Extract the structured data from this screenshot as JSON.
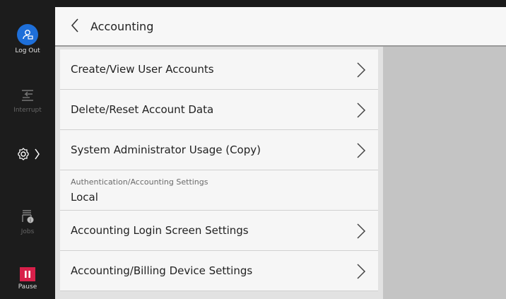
{
  "rail": {
    "logout_label": "Log Out",
    "interrupt_label": "Interrupt",
    "jobs_label": "Jobs",
    "pause_label": "Pause"
  },
  "header": {
    "title": "Accounting"
  },
  "menu": {
    "create_view": "Create/View User Accounts",
    "delete_reset": "Delete/Reset Account Data",
    "sysadmin_usage": "System Administrator Usage (Copy)",
    "auth_settings_label": "Authentication/Accounting Settings",
    "auth_settings_value": "Local",
    "login_screen": "Accounting Login Screen Settings",
    "billing_device": "Accounting/Billing Device Settings"
  },
  "colors": {
    "accent_blue": "#1e6fd9",
    "pause_red": "#d8204a",
    "rail_bg": "#1c1c1c"
  }
}
